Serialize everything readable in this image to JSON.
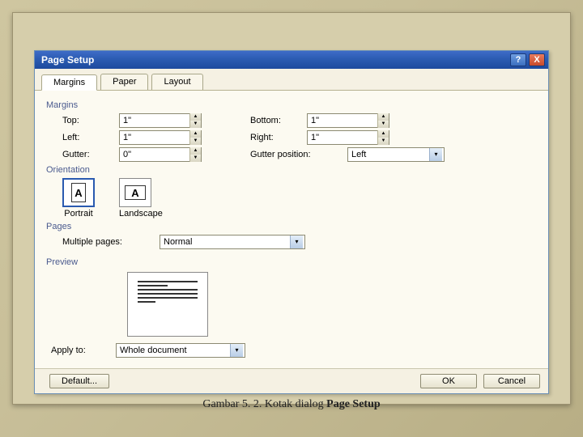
{
  "dialog": {
    "title": "Page Setup",
    "help": "?",
    "close": "X"
  },
  "tabs": {
    "margins": "Margins",
    "paper": "Paper",
    "layout": "Layout"
  },
  "margins": {
    "group": "Margins",
    "top_lbl": "Top:",
    "top_val": "1\"",
    "bottom_lbl": "Bottom:",
    "bottom_val": "1\"",
    "left_lbl": "Left:",
    "left_val": "1\"",
    "right_lbl": "Right:",
    "right_val": "1\"",
    "gutter_lbl": "Gutter:",
    "gutter_val": "0\"",
    "gutter_pos_lbl": "Gutter position:",
    "gutter_pos_val": "Left"
  },
  "orientation": {
    "group": "Orientation",
    "portrait": "Portrait",
    "landscape": "Landscape",
    "letter": "A"
  },
  "pages": {
    "group": "Pages",
    "multi_lbl": "Multiple pages:",
    "multi_val": "Normal"
  },
  "preview": {
    "group": "Preview"
  },
  "apply": {
    "lbl": "Apply to:",
    "val": "Whole document"
  },
  "buttons": {
    "default": "Default...",
    "ok": "OK",
    "cancel": "Cancel"
  },
  "caption": {
    "pre": "Gambar 5. 2. Kotak dialog ",
    "bold": "Page Setup"
  }
}
